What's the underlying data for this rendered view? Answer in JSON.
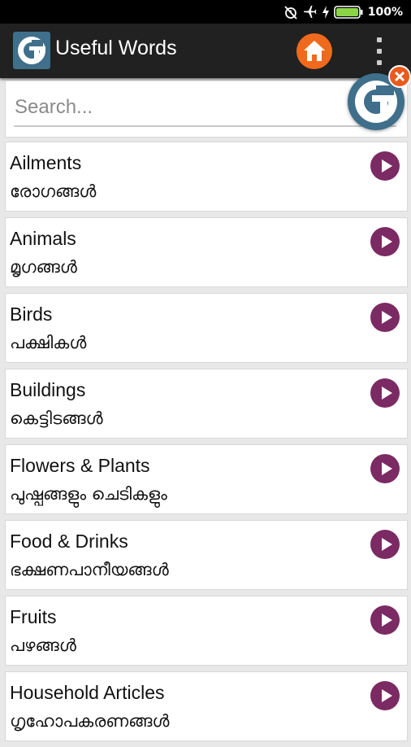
{
  "status_bar": {
    "battery": "100%",
    "icons": [
      "alarm-off-icon",
      "airplane-icon",
      "charging-icon",
      "battery-icon"
    ]
  },
  "app_bar": {
    "title": "Useful Words",
    "icons": [
      "app-logo-icon",
      "home-icon",
      "overflow-menu-icon"
    ]
  },
  "search": {
    "placeholder": "Search..."
  },
  "items": [
    {
      "title": "Ailments",
      "subtitle": "രോഗങ്ങൾ"
    },
    {
      "title": "Animals",
      "subtitle": "മൃഗങ്ങൾ"
    },
    {
      "title": "Birds",
      "subtitle": "പക്ഷികൾ"
    },
    {
      "title": "Buildings",
      "subtitle": "കെട്ടിടങ്ങൾ"
    },
    {
      "title": "Flowers & Plants",
      "subtitle": "പുഷ്പങ്ങളും ചെടികളും"
    },
    {
      "title": "Food & Drinks",
      "subtitle": "ഭക്ഷണപാനീയങ്ങൾ"
    },
    {
      "title": "Fruits",
      "subtitle": "പഴങ്ങൾ"
    },
    {
      "title": "Household Articles",
      "subtitle": "ഗൃഹോപകരണങ്ങൾ"
    }
  ],
  "colors": {
    "app_bar": "#212121",
    "home_button": "#f06a1e",
    "play_button": "#7b2a63",
    "logo": "#3f6f8a",
    "battery": "#8bd44a"
  }
}
